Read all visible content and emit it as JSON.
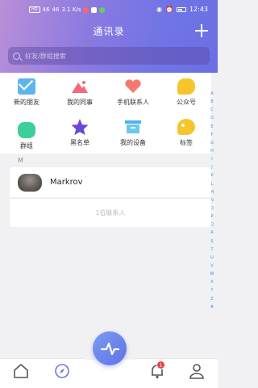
{
  "statusbar": {
    "time": "12:43",
    "left_items": [
      "HD",
      "46",
      "46",
      "3.1 K/s"
    ]
  },
  "header": {
    "title": "通讯录",
    "search_placeholder": "好友/群组搜索"
  },
  "shortcuts": [
    {
      "label": "新的朋友",
      "icon": "mail-icon"
    },
    {
      "label": "我的同事",
      "icon": "mountain-icon"
    },
    {
      "label": "手机联系人",
      "icon": "heart-icon"
    },
    {
      "label": "公众号",
      "icon": "chat-bubble-icon"
    },
    {
      "label": "群组",
      "icon": "cloud-icon"
    },
    {
      "label": "黑名单",
      "icon": "star-icon"
    },
    {
      "label": "我的设备",
      "icon": "device-icon"
    },
    {
      "label": "标签",
      "icon": "tag-icon"
    }
  ],
  "alphabet": [
    "A",
    "B",
    "C",
    "D",
    "E",
    "F",
    "G",
    "H",
    "I",
    "J",
    "K",
    "L",
    "M",
    "N",
    "O",
    "P",
    "Q",
    "R",
    "S",
    "T",
    "U",
    "V",
    "W",
    "X",
    "Y",
    "Z",
    "#"
  ],
  "section_letter": "M",
  "contacts": [
    {
      "name": "Markrov"
    }
  ],
  "contact_count": "1位联系人",
  "tabbar": {
    "badge_count": "1"
  },
  "colors": {
    "accent": "#6f74e6",
    "alphabet": "#4a8de6",
    "badge": "#f04040"
  }
}
